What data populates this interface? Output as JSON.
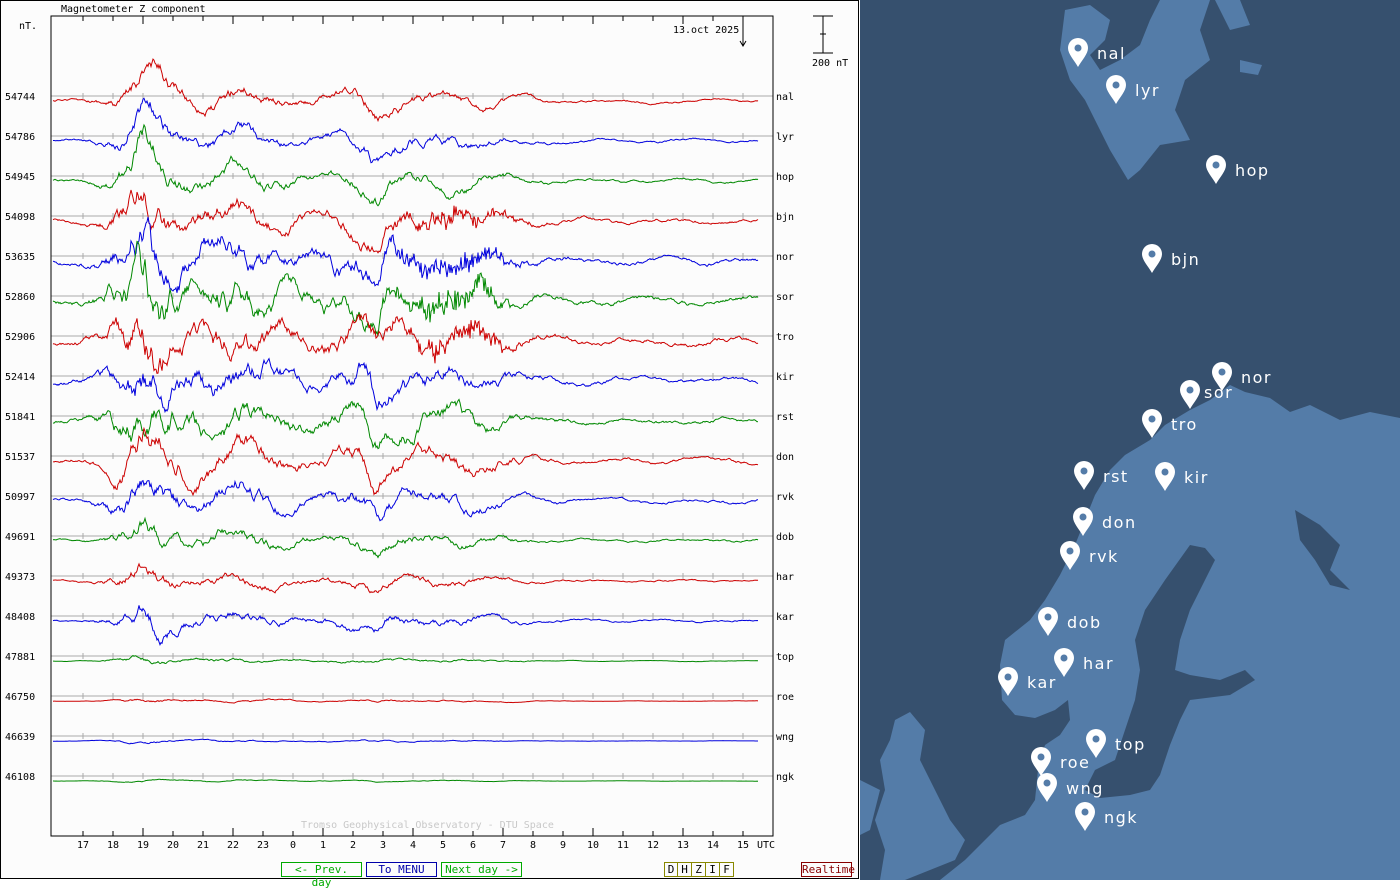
{
  "chart_data": {
    "type": "line",
    "title": "Magnetometer Z component",
    "ylabel": "nT.",
    "date_label": "13.oct 2025",
    "scale_label": "200 nT",
    "scale_nT": 200,
    "credit": "Tromso Geophysical Observatory - DTU Space",
    "xlabel": "UTC",
    "x_ticks": [
      "17",
      "18",
      "19",
      "20",
      "21",
      "22",
      "23",
      "0",
      "1",
      "2",
      "3",
      "4",
      "5",
      "6",
      "7",
      "8",
      "9",
      "10",
      "11",
      "12",
      "13",
      "14",
      "15"
    ],
    "x_range_hours_utc": [
      16,
      15.5
    ],
    "current_time_hour": 15,
    "grid": true,
    "series": [
      {
        "name": "nal",
        "baseline": "54744",
        "color": "#cc0000",
        "activity": 1.0
      },
      {
        "name": "lyr",
        "baseline": "54786",
        "color": "#0000dd",
        "activity": 1.0
      },
      {
        "name": "hop",
        "baseline": "54945",
        "color": "#008800",
        "activity": 1.1
      },
      {
        "name": "bjn",
        "baseline": "54098",
        "color": "#cc0000",
        "activity": 1.5
      },
      {
        "name": "nor",
        "baseline": "53635",
        "color": "#0000dd",
        "activity": 2.0
      },
      {
        "name": "sor",
        "baseline": "52860",
        "color": "#008800",
        "activity": 2.2
      },
      {
        "name": "tro",
        "baseline": "52906",
        "color": "#cc0000",
        "activity": 2.0
      },
      {
        "name": "kir",
        "baseline": "52414",
        "color": "#0000dd",
        "activity": 1.8
      },
      {
        "name": "rst",
        "baseline": "51841",
        "color": "#008800",
        "activity": 1.7
      },
      {
        "name": "don",
        "baseline": "51537",
        "color": "#cc0000",
        "activity": 1.5
      },
      {
        "name": "rvk",
        "baseline": "50997",
        "color": "#0000dd",
        "activity": 1.3
      },
      {
        "name": "dob",
        "baseline": "49691",
        "color": "#008800",
        "activity": 0.9
      },
      {
        "name": "har",
        "baseline": "49373",
        "color": "#cc0000",
        "activity": 0.7
      },
      {
        "name": "kar",
        "baseline": "48408",
        "color": "#0000dd",
        "activity": 0.8
      },
      {
        "name": "top",
        "baseline": "47881",
        "color": "#008800",
        "activity": 0.25
      },
      {
        "name": "roe",
        "baseline": "46750",
        "color": "#cc0000",
        "activity": 0.15
      },
      {
        "name": "wng",
        "baseline": "46639",
        "color": "#0000dd",
        "activity": 0.12
      },
      {
        "name": "ngk",
        "baseline": "46108",
        "color": "#008800",
        "activity": 0.08
      }
    ]
  },
  "nav": {
    "prev_day": "<- Prev. day",
    "menu": "To MENU",
    "next_day": "Next day ->",
    "components": [
      "D",
      "H",
      "Z",
      "I",
      "F"
    ],
    "realtime": "Realtime"
  },
  "map": {
    "colors": {
      "sea": "#36506e",
      "land": "#547ca8",
      "pin": "#ffffff"
    },
    "stations": [
      "nal",
      "lyr",
      "hop",
      "bjn",
      "nor",
      "sor",
      "tro",
      "kir",
      "rst",
      "don",
      "rvk",
      "dob",
      "har",
      "kar",
      "top",
      "roe",
      "wng",
      "ngk"
    ]
  }
}
